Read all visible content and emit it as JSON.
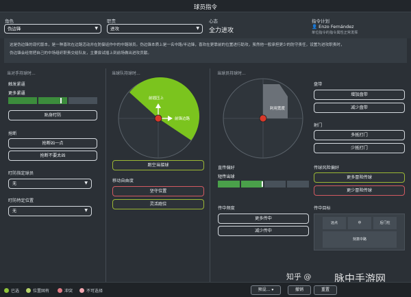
{
  "window": {
    "title": "球员指令"
  },
  "header": {
    "role_label": "角色",
    "role_value": "伪边锋",
    "duty_label": "职责",
    "duty_value": "进攻",
    "mentality_label": "心态",
    "mentality_value": "全力进攻",
    "author_label": "指令计划",
    "author_name": "Enzo Fernández",
    "author_sub": "单位指令的指令属性正常发挥"
  },
  "description": {
    "line1": "这是伪边锋的现代版本，是一种喜欢在边路活动并在防御运作中的中路球员。伪边锋本质上是一名中路/半边锋，喜欢在更靠前的位置进行助攻，虽然他一般承担更少的防守责任，设置为进攻职责时，",
    "line2": "伪边锋会经常把自己的中场组织职责交给队友，主要尝试插上到前场做出进攻贡献。"
  },
  "sections": {
    "left": "当对手持球时...",
    "middle": "当球队持球时...",
    "right": "当球员持球时..."
  },
  "left": {
    "pressing_label": "触发紧逼",
    "pressing_value": "更多紧逼",
    "pressing_level": 0.66,
    "close_down_btn": "贴身盯防",
    "tackle_label": "抢断",
    "tackle_more": "抢断凶一点",
    "tackle_less": "抢断不要太凶",
    "mark_player_label": "盯防指定球员",
    "mark_player_value": "无",
    "mark_position_label": "盯防特定位置",
    "mark_position_value": "无"
  },
  "middle": {
    "zone_main": "前插压上",
    "zone_side": "前锋边路",
    "hold_btn": "跑空当接球",
    "free_role_label": "移动自由度",
    "stay_wider_btn": "坚守位置",
    "roam_btn": "灵活跑位",
    "cross_pref_label": "直传偏好",
    "cross_value": "短传出球",
    "cross_level": 0.5,
    "cross_freq_label": "传中频度",
    "cross_more_btn": "更多传中",
    "cross_less_btn": "减少传中"
  },
  "right": {
    "dribble_label": "盘带",
    "dribble_more": "增加盘带",
    "dribble_less": "减少盘带",
    "zone_label": "利用宽度",
    "shoot_label": "射门",
    "shoot_more": "多抵打门",
    "shoot_less": "少抵打门",
    "risk_label": "传球风险偏好",
    "risk_more": "更多冒险传球",
    "risk_less": "更少冒险传球",
    "target_label": "传中目标",
    "cell1": "远点",
    "cell2": "中",
    "cell3": "后门柱",
    "cell4": "刻意中路"
  },
  "footer": {
    "legend": [
      {
        "label": "已选",
        "color": "#8fc43a"
      },
      {
        "label": "位置固有",
        "color": "#b7d36a"
      },
      {
        "label": "冲突",
        "color": "#e07b85"
      },
      {
        "label": "不可选择",
        "color": "#f2a7b0"
      }
    ],
    "preset_btn": "预设...",
    "cancel_btn": "撤销",
    "reset_btn": "重置"
  },
  "watermark": {
    "text1": "知乎 @",
    "text2": "脉中手游网"
  },
  "colors": {
    "accent_green": "#8fc43a",
    "zone_green": "#7bc41e",
    "player_red": "#d9382a",
    "conflict_red": "#d45a62"
  }
}
